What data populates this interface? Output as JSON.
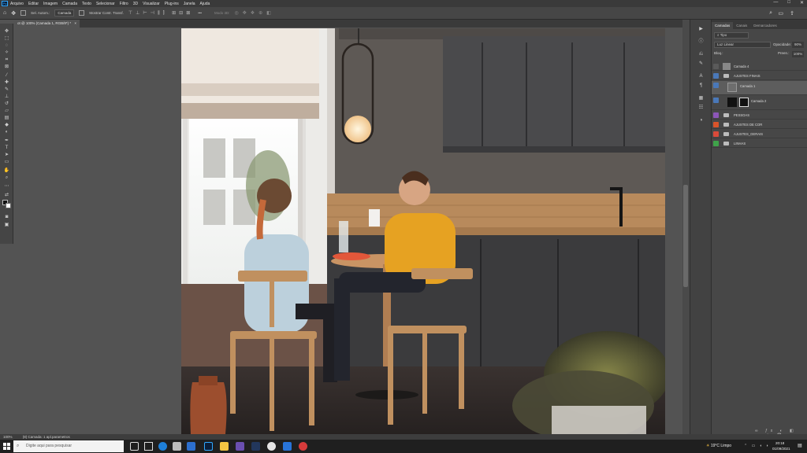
{
  "app": {
    "logo": "Ps"
  },
  "menu": [
    "Arquivo",
    "Editar",
    "Imagem",
    "Camada",
    "Texto",
    "Selecionar",
    "Filtro",
    "3D",
    "Visualizar",
    "Plug-ins",
    "Janela",
    "Ajuda"
  ],
  "window_controls": [
    "—",
    "□",
    "✕"
  ],
  "options": {
    "auto_select_label": "Sel. Autom.:",
    "auto_select_value": "Camada",
    "transform_label": "Mostrar Contr. Transf.",
    "mode_3d": "Modo 3D:",
    "more": "•••"
  },
  "document": {
    "tab_title": "ot @ 100% (Camada 1, RGB/8*) *",
    "close": "×"
  },
  "panels": {
    "tabs": [
      "Camadas",
      "Canais",
      "Demarcadores"
    ],
    "filter": "Tipo",
    "blend_mode": "Luz Linear",
    "opacity_label": "Opacidade:",
    "opacity_value": "90%",
    "lock_label": "Bloq.:",
    "fill_label": "Preen.:",
    "fill_value": "100%",
    "layers": [
      {
        "name": "Camada 4",
        "eye": "#5a5a5a"
      },
      {
        "name": "AJUSTES FINAIS",
        "eye": "#4a78b8"
      },
      {
        "name": "Camada 1",
        "eye": "#4a78b8"
      },
      {
        "name": "Camada 2",
        "eye": "#4a78b8"
      },
      {
        "name": "PESSOAS",
        "eye": "#8c56b8"
      },
      {
        "name": "AJUSTES DE COR",
        "eye": "#d9542b"
      },
      {
        "name": "AJUSTES_GERAIS",
        "eye": "#d94a3a"
      },
      {
        "name": "LINHAS",
        "eye": "#3fa34a"
      }
    ]
  },
  "status": {
    "zoom": "100%",
    "info": "(8) Camada: 1 apl.parametros"
  },
  "taskbar": {
    "search_placeholder": "Digite aqui para pesquisar",
    "weather": "19°C  Limpo",
    "time": "20:18",
    "date": "01/09/2021"
  }
}
